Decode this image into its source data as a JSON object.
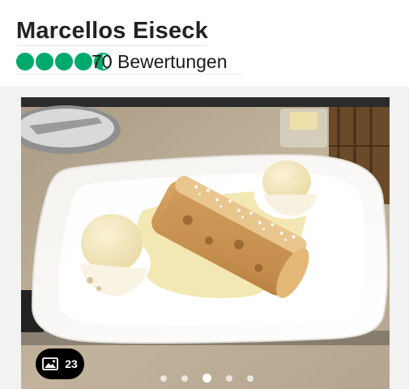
{
  "restaurant": {
    "name": "Marcellos Eiseck",
    "rating": 4.5,
    "rating_max": 5,
    "review_count_text": "70 Bewertungen",
    "brand_color": "#00aa6c"
  },
  "gallery": {
    "photo_count": "23",
    "photo_icon": "image-icon",
    "carousel": {
      "total": 5,
      "active_index": 2
    }
  }
}
